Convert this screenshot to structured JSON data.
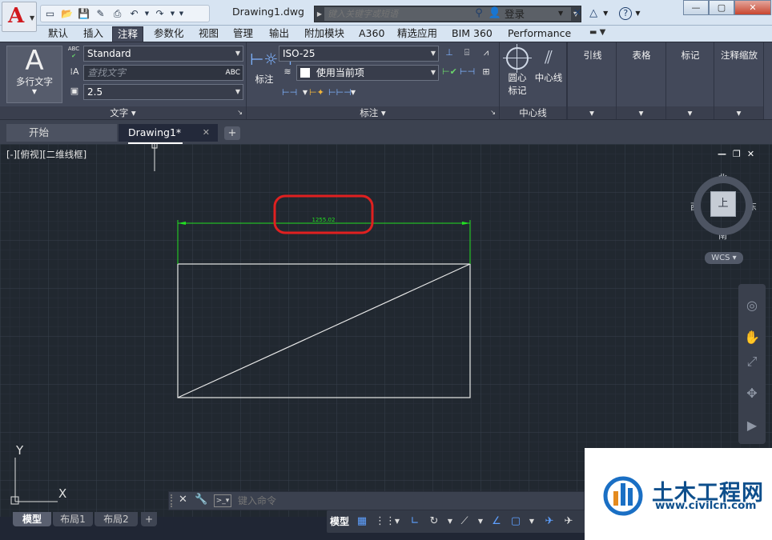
{
  "app": {
    "logo_letter": "A",
    "doc_title": "Drawing1.dwg"
  },
  "search": {
    "placeholder": "键入关键字或短语"
  },
  "account": {
    "login_label": "登录"
  },
  "ribbon_tabs": [
    "默认",
    "插入",
    "注释",
    "参数化",
    "视图",
    "管理",
    "输出",
    "附加模块",
    "A360",
    "精选应用",
    "BIM 360",
    "Performance"
  ],
  "active_tab": "注释",
  "text_panel": {
    "big_button": "多行文字",
    "style_label": "ABC",
    "style_value": "Standard",
    "find_placeholder": "查找文字",
    "height_value": "2.5",
    "footer": "文字"
  },
  "dim_panel": {
    "big_button": "标注",
    "dimstyle_value": "ISO-25",
    "layer_value": "使用当前项",
    "footer": "标注"
  },
  "center_panel": {
    "center_mark_1": "圆心",
    "center_mark_2": "标记",
    "centerline": "中心线",
    "footer": "中心线"
  },
  "extra_panels": [
    "引线",
    "表格",
    "标记",
    "注释缩放"
  ],
  "file_tabs": {
    "start": "开始",
    "doc": "Drawing1*"
  },
  "viewport": {
    "label": "[-][俯视][二维线框]"
  },
  "viewcube": {
    "north": "北",
    "south": "南",
    "east": "东",
    "west": "西",
    "face": "上",
    "wcs": "WCS"
  },
  "drawing": {
    "dimension_text": "1255.02",
    "dim_color": "#22e022",
    "highlight_color": "#e02020"
  },
  "ucs": {
    "x": "X",
    "y": "Y"
  },
  "command": {
    "placeholder": "键入命令"
  },
  "layout_tabs": [
    "模型",
    "布局1",
    "布局2"
  ],
  "status": {
    "model_label": "模型"
  },
  "watermark": {
    "title": "土木工程网",
    "url": "www.civilcn.com"
  }
}
